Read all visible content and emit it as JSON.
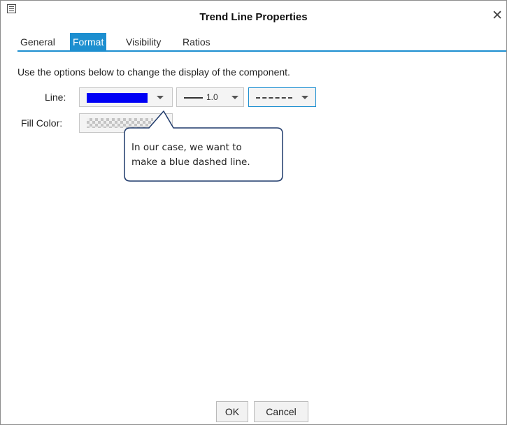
{
  "dialog": {
    "title": "Trend Line Properties",
    "window_icon": "list-icon",
    "close_glyph": "✕"
  },
  "tabs": [
    {
      "label": "General",
      "active": false
    },
    {
      "label": "Format",
      "active": true
    },
    {
      "label": "Visibility",
      "active": false
    },
    {
      "label": "Ratios",
      "active": false
    }
  ],
  "content": {
    "instructions": "Use the options below to change the display of the component.",
    "line_label": "Line:",
    "line_color": "#0000f5",
    "line_weight": "1.0",
    "line_style": "dashed",
    "fill_color_label": "Fill Color:",
    "fill_color": "transparent"
  },
  "callout": {
    "text_line1": "In our case, we want to",
    "text_line2": "make a blue dashed line."
  },
  "buttons": {
    "ok": "OK",
    "cancel": "Cancel"
  },
  "colors": {
    "accent": "#1d8fd0",
    "callout_border": "#1f3a6b"
  }
}
